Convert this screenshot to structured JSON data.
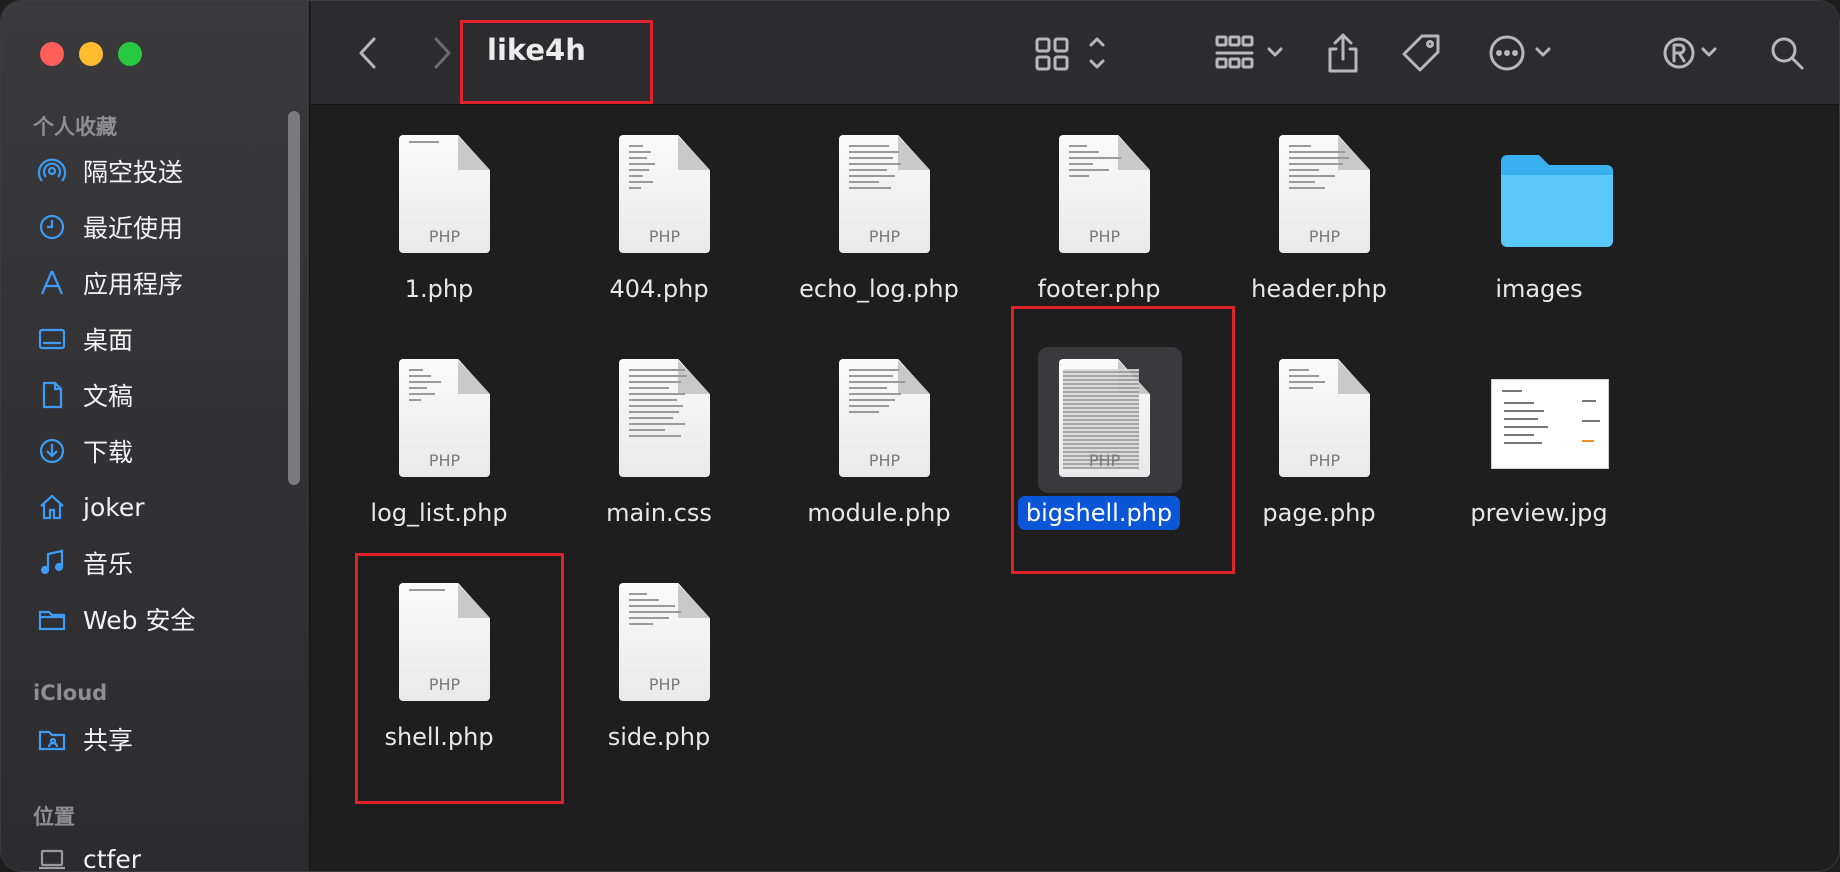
{
  "window": {
    "title": "like4h"
  },
  "sidebar": {
    "sections": [
      {
        "title": "个人收藏",
        "items": [
          {
            "label": "隔空投送",
            "icon": "airdrop-icon"
          },
          {
            "label": "最近使用",
            "icon": "clock-icon"
          },
          {
            "label": "应用程序",
            "icon": "applications-icon"
          },
          {
            "label": "桌面",
            "icon": "desktop-icon"
          },
          {
            "label": "文稿",
            "icon": "document-icon"
          },
          {
            "label": "下载",
            "icon": "download-icon"
          },
          {
            "label": "joker",
            "icon": "home-icon"
          },
          {
            "label": "音乐",
            "icon": "music-icon"
          },
          {
            "label": "Web 安全",
            "icon": "folder-icon"
          }
        ]
      },
      {
        "title": "iCloud",
        "items": [
          {
            "label": "共享",
            "icon": "shared-folder-icon"
          }
        ]
      },
      {
        "title": "位置",
        "items": [
          {
            "label": "ctfer",
            "icon": "laptop-icon"
          }
        ]
      }
    ]
  },
  "toolbar": {
    "back": "chevron-left-icon",
    "forward": "chevron-right-icon",
    "view": "grid-view-icon",
    "group": "group-icon",
    "share": "share-icon",
    "tags": "tag-icon",
    "more": "ellipsis-icon",
    "extension": "registered-icon",
    "search": "search-icon"
  },
  "files": [
    {
      "name": "1.php",
      "kind": "PHP"
    },
    {
      "name": "404.php",
      "kind": "PHP"
    },
    {
      "name": "echo_log.php",
      "kind": "PHP"
    },
    {
      "name": "footer.php",
      "kind": "PHP"
    },
    {
      "name": "header.php",
      "kind": "PHP"
    },
    {
      "name": "images",
      "kind": "folder"
    },
    {
      "name": "log_list.php",
      "kind": "PHP"
    },
    {
      "name": "main.css",
      "kind": "css"
    },
    {
      "name": "module.php",
      "kind": "PHP"
    },
    {
      "name": "bigshell.php",
      "kind": "PHP",
      "selected": true
    },
    {
      "name": "page.php",
      "kind": "PHP"
    },
    {
      "name": "preview.jpg",
      "kind": "jpg"
    },
    {
      "name": "shell.php",
      "kind": "PHP"
    },
    {
      "name": "side.php",
      "kind": "PHP"
    }
  ],
  "colors": {
    "selection": "#0a56d6",
    "annotation": "#e0232a",
    "folder": "#5ac8fa"
  }
}
